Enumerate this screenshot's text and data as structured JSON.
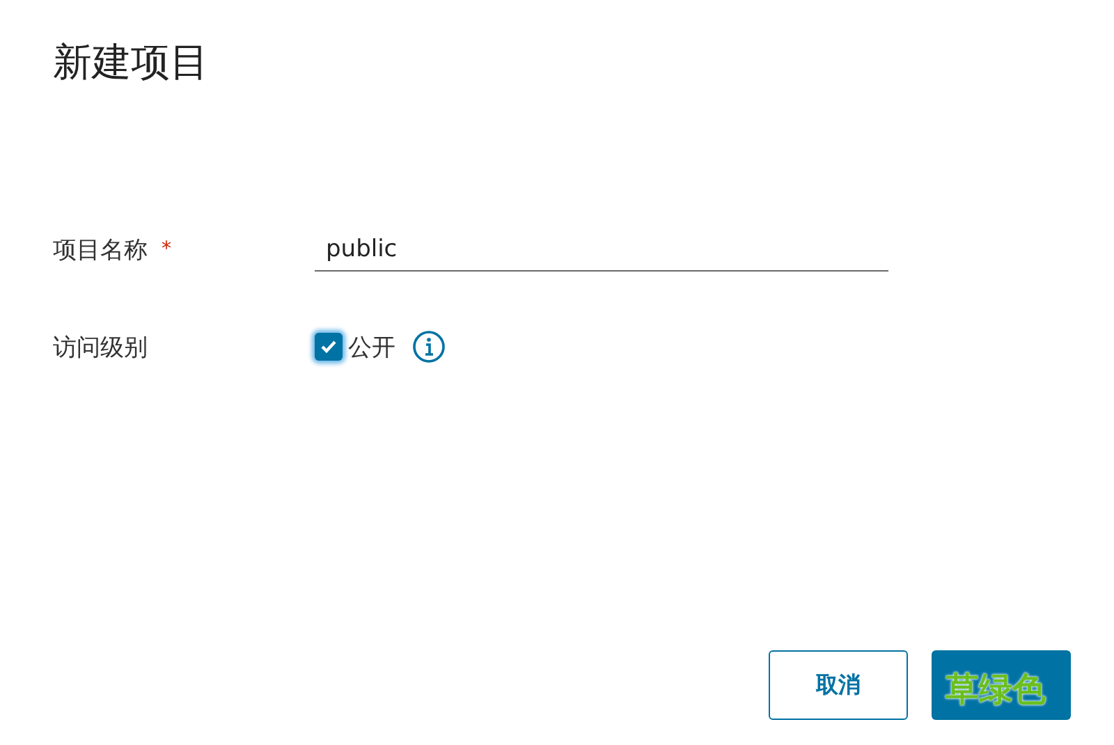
{
  "dialog": {
    "title": "新建项目"
  },
  "fields": [
    {
      "kind": "text",
      "label": "项目名称",
      "required_mark": "*",
      "value": "public"
    },
    {
      "kind": "checkbox",
      "label": "访问级别",
      "option": "公开",
      "checked": true,
      "info": true
    }
  ],
  "buttons": [
    {
      "kind": "secondary",
      "label": "取消"
    },
    {
      "kind": "primary",
      "annotation": "草绿色"
    }
  ]
}
